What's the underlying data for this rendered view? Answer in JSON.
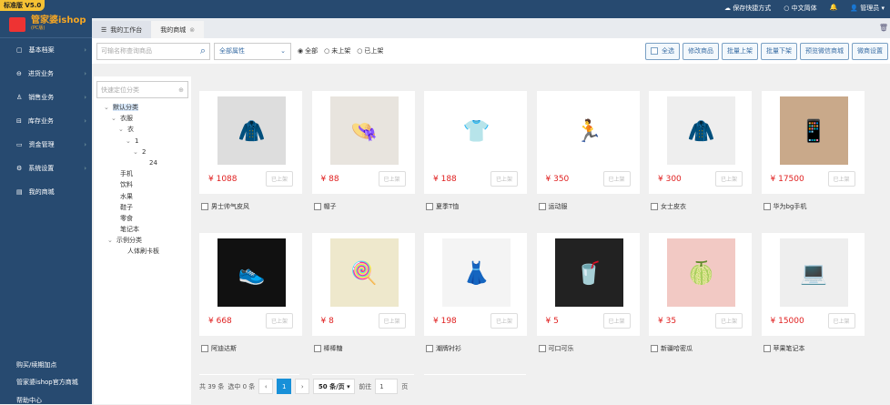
{
  "version": "标准版 V5.0",
  "brand": {
    "name": "管家婆ishop",
    "sub": "(PC版)"
  },
  "topbar": {
    "shortcut": "保存快捷方式",
    "lang": "中文简体",
    "user": "管理员"
  },
  "sidebar": {
    "items": [
      {
        "label": "基本档案",
        "icon": "archive-icon"
      },
      {
        "label": "进货业务",
        "icon": "purchase-icon"
      },
      {
        "label": "销售业务",
        "icon": "sales-icon"
      },
      {
        "label": "库存业务",
        "icon": "inventory-icon"
      },
      {
        "label": "资金管理",
        "icon": "wallet-icon"
      },
      {
        "label": "系统设置",
        "icon": "gear-icon"
      },
      {
        "label": "我的商城",
        "icon": "store-icon"
      }
    ],
    "bottom": [
      "购买/续期加点",
      "管家婆ishop官方商城",
      "帮助中心"
    ]
  },
  "tabs": [
    {
      "label": "我的工作台"
    },
    {
      "label": "我的商城"
    }
  ],
  "toolbar": {
    "search_placeholder": "可输名称查询商品",
    "filter": "全部属性",
    "radios": [
      "全部",
      "未上架",
      "已上架"
    ],
    "buttons": [
      "全选",
      "修改商品",
      "批量上架",
      "批量下架",
      "预览微信商城",
      "微商设置"
    ]
  },
  "tree": {
    "placeholder": "快速定位分类",
    "nodes": [
      {
        "label": "默认分类",
        "lvl": 0,
        "exp": true
      },
      {
        "label": "衣服",
        "lvl": 1,
        "exp": true
      },
      {
        "label": "衣",
        "lvl": 2,
        "exp": true
      },
      {
        "label": "1",
        "lvl": 3,
        "exp": true
      },
      {
        "label": "2",
        "lvl": 4,
        "exp": true
      },
      {
        "label": "24",
        "lvl": 5
      },
      {
        "label": "手机",
        "lvl": 1
      },
      {
        "label": "饮料",
        "lvl": 1
      },
      {
        "label": "水果",
        "lvl": 1
      },
      {
        "label": "鞋子",
        "lvl": 1
      },
      {
        "label": "零食",
        "lvl": 1
      },
      {
        "label": "笔记本",
        "lvl": 1
      },
      {
        "label": "示例分类",
        "lvl": 0.5,
        "exp": true
      },
      {
        "label": "人体刷卡板",
        "lvl": 2
      }
    ]
  },
  "products": [
    {
      "name": "男士帅气皮风",
      "price": "¥ 1088",
      "icon": "🧥",
      "bg": "#ddd"
    },
    {
      "name": "帽子",
      "price": "¥ 88",
      "icon": "👒",
      "bg": "#e8e4de"
    },
    {
      "name": "夏季T恤",
      "price": "¥ 188",
      "icon": "👕",
      "bg": "#fff"
    },
    {
      "name": "运动服",
      "price": "¥ 350",
      "icon": "🏃",
      "bg": "#fff"
    },
    {
      "name": "女士皮衣",
      "price": "¥ 300",
      "icon": "🧥",
      "bg": "#eee"
    },
    {
      "name": "华为bg手机",
      "price": "¥ 17500",
      "icon": "📱",
      "bg": "#c9a98a"
    },
    {
      "name": "阿迪达斯",
      "price": "¥ 668",
      "icon": "👟",
      "bg": "#111"
    },
    {
      "name": "棒棒糖",
      "price": "¥ 8",
      "icon": "🍭",
      "bg": "#eee8cc"
    },
    {
      "name": "潮牌衬衫",
      "price": "¥ 198",
      "icon": "👗",
      "bg": "#f4f4f4"
    },
    {
      "name": "可口可乐",
      "price": "¥ 5",
      "icon": "🥤",
      "bg": "#222"
    },
    {
      "name": "新疆哈密瓜",
      "price": "¥ 35",
      "icon": "🍈",
      "bg": "#f2c9c4"
    },
    {
      "name": "苹果笔记本",
      "price": "¥ 15000",
      "icon": "💻",
      "bg": "#eee"
    }
  ],
  "up_label": "已上架",
  "pagination": {
    "total": "共 39 条",
    "selected": "选中 0 条",
    "page": "1",
    "size": "50 条/页",
    "goto": "前往",
    "goto_val": "1",
    "suffix": "页"
  }
}
